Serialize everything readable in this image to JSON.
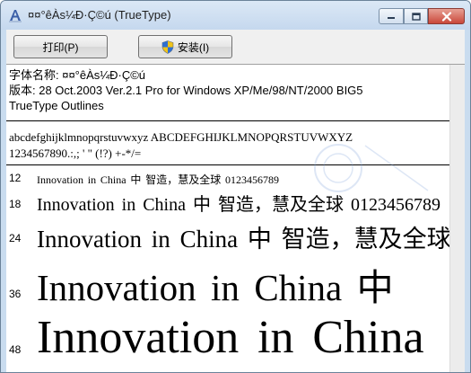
{
  "window": {
    "title": "¤¤°êÀs¼Ð·Ç©ú (TrueType)",
    "controls": {
      "minimize": "minimize",
      "maximize": "maximize",
      "close": "close"
    }
  },
  "toolbar": {
    "print_label": "打印(P)",
    "install_label": "安装(I)"
  },
  "font_info": {
    "name_line": "字体名称: ¤¤°êÀs¼Ð·Ç©ú",
    "version_line": "版本: 28 Oct.2003 Ver.2.1 Pro for Windows XP/Me/98/NT/2000 BIG5",
    "type_line": "TrueType Outlines"
  },
  "charset": {
    "lower": "abcdefghijklmnopqrstuvwxyz  ABCDEFGHIJKLMNOPQRSTUVWXYZ",
    "digits": "1234567890.:,; ' \" (!?)  +-*/="
  },
  "samples": [
    {
      "size": "12",
      "text": "Innovation in China 中 智造，慧及全球 0123456789"
    },
    {
      "size": "18",
      "text": "Innovation in China 中 智造，慧及全球 0123456789"
    },
    {
      "size": "24",
      "text": "Innovation in China 中 智造，慧及全球"
    },
    {
      "size": "36",
      "text": "Innovation in China 中"
    },
    {
      "size": "48",
      "text": "Innovation in China"
    }
  ],
  "colors": {
    "frame": "#c9dcef",
    "close": "#c9473a",
    "text": "#000000"
  }
}
